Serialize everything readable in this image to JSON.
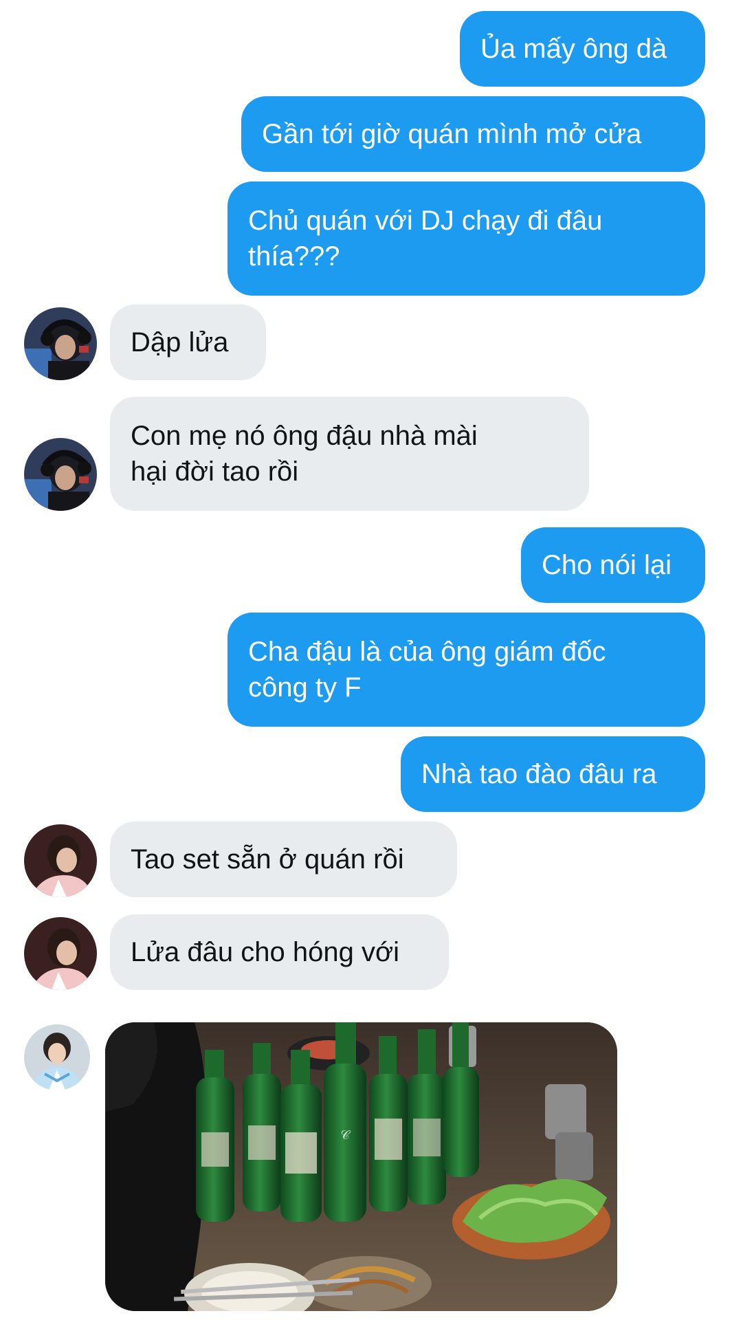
{
  "messages": [
    {
      "id": "m1",
      "direction": "sent",
      "text": "Ủa mấy ông dà"
    },
    {
      "id": "m2",
      "direction": "sent",
      "text": "Gần tới giờ quán mình mở cửa"
    },
    {
      "id": "m3",
      "direction": "sent",
      "text": "Chủ quán với DJ chạy đi đâu\nthía???"
    },
    {
      "id": "m4",
      "direction": "received",
      "sender_avatar": "avatar-headset",
      "text": "Dập lửa"
    },
    {
      "id": "m5",
      "direction": "received",
      "sender_avatar": "avatar-headset",
      "text": "Con mẹ nó ông đậu nhà mài\nhại đời tao rồi"
    },
    {
      "id": "m6",
      "direction": "sent",
      "text": "Cho nói lại"
    },
    {
      "id": "m7",
      "direction": "sent",
      "text": "Cha đậu là của ông giám đốc\ncông ty F"
    },
    {
      "id": "m8",
      "direction": "sent",
      "text": "Nhà tao đào đâu ra"
    },
    {
      "id": "m9",
      "direction": "received",
      "sender_avatar": "avatar-pink-jacket",
      "text": "Tao set sẵn ở quán rồi"
    },
    {
      "id": "m10",
      "direction": "received",
      "sender_avatar": "avatar-pink-jacket",
      "text": "Lửa đâu cho hóng với"
    },
    {
      "id": "m11",
      "direction": "received",
      "sender_avatar": "avatar-hanbok",
      "type": "photo",
      "photo_description_icon": "photo-soju-bottles-on-table"
    }
  ],
  "colors": {
    "sent_bubble": "#1d9bf0",
    "received_bubble": "#e9ecef",
    "sent_text": "#ffffff",
    "received_text": "#0f1419"
  }
}
